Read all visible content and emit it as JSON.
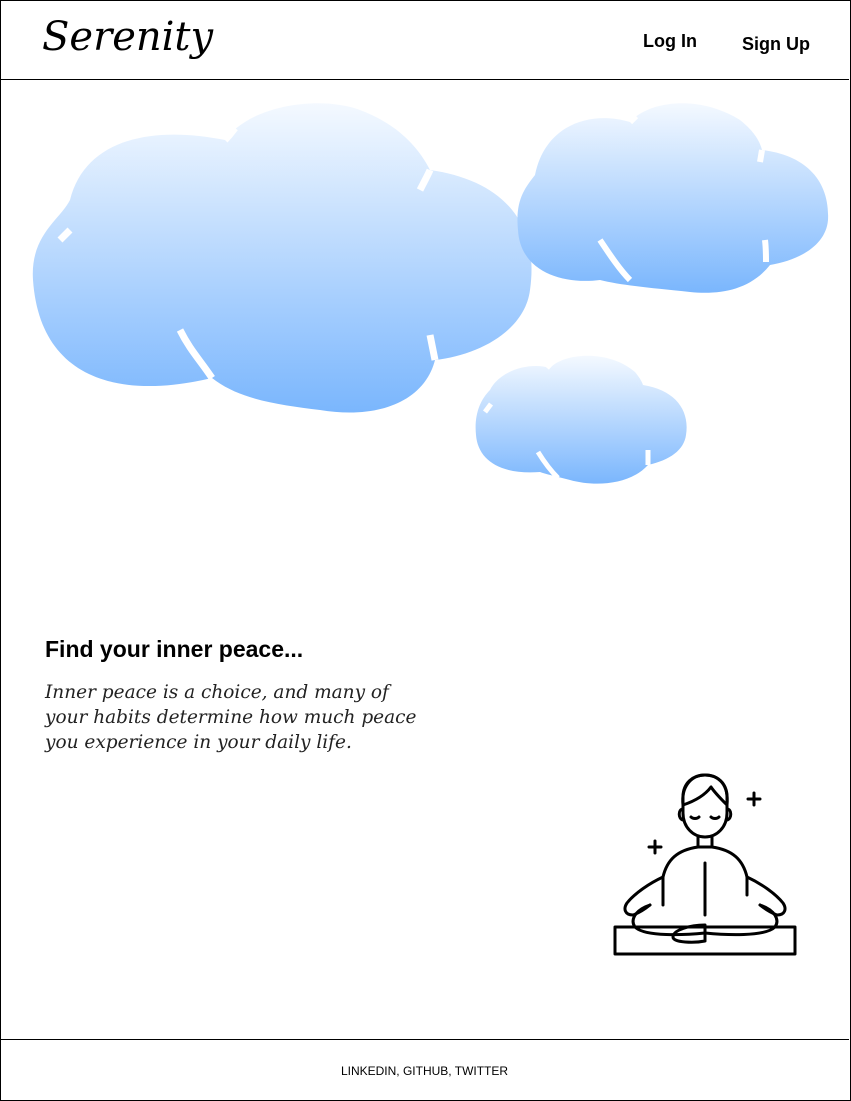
{
  "header": {
    "logo": "Serenity",
    "login_label": "Log In",
    "signup_label": "Sign Up"
  },
  "hero": {
    "title": "Find your inner peace...",
    "text": "Inner peace is a choice, and many of your habits determine how much peace you experience in your daily life."
  },
  "footer": {
    "links": "LINKEDIN, GITHUB, TWITTER"
  },
  "colors": {
    "cloud_top": "#ffffff",
    "cloud_bottom": "#7ab6fd",
    "border": "#000000"
  },
  "icons": [
    "cloud-icon",
    "meditation-person-icon",
    "sparkle-icon"
  ]
}
